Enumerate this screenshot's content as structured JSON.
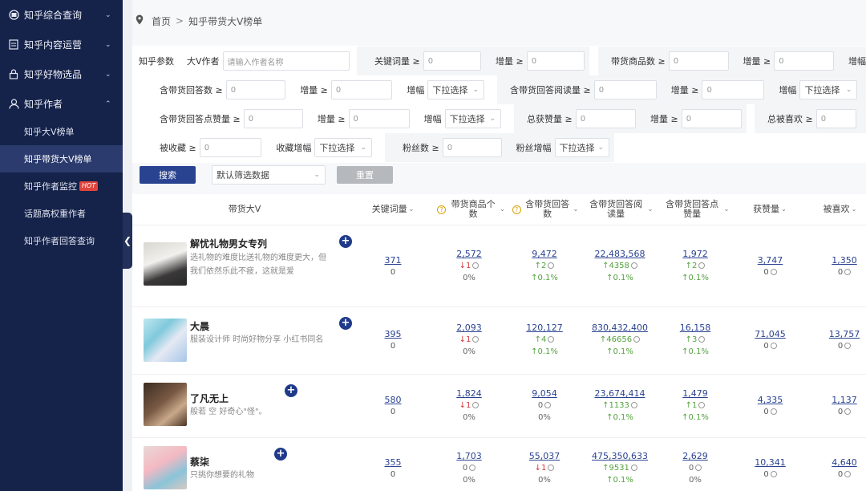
{
  "sidebar": {
    "groups": [
      {
        "label": "知乎综合查询",
        "icon": "globe-icon"
      },
      {
        "label": "知乎内容运营",
        "icon": "document-icon"
      },
      {
        "label": "知乎好物选品",
        "icon": "lock-icon"
      },
      {
        "label": "知乎作者",
        "icon": "user-icon"
      }
    ],
    "sub_items": [
      {
        "label": "知乎大V榜单"
      },
      {
        "label": "知乎带货大V榜单"
      },
      {
        "label": "知乎作者监控",
        "badge": "HOT"
      },
      {
        "label": "话题高权重作者"
      },
      {
        "label": "知乎作者回答查询"
      }
    ]
  },
  "breadcrumb": {
    "home": "首页",
    "separator": ">",
    "current": "知乎带货大V榜单"
  },
  "filters": {
    "section_label": "知乎参数",
    "author_label": "大V作者",
    "author_placeholder": "请输入作者名称",
    "keyword_label": "关键词量 ≥",
    "keyword_value": "0",
    "incr_label": "增量 ≥",
    "incr_value": "0",
    "goods_label": "带货商品数 ≥",
    "goods_value": "0",
    "growth_label": "增幅",
    "dropdown_text": "下拉选择",
    "answers_label": "含带货回答数 ≥",
    "answers_value": "0",
    "reads_label": "含带货回答阅读量 ≥",
    "reads_value": "0",
    "likes_label": "含带货回答点赞量 ≥",
    "likes_value": "0",
    "total_likes_label": "总获赞量 ≥",
    "total_likes_value": "0",
    "total_fav_label": "总被喜欢 ≥",
    "total_fav_value": "0",
    "collect_label": "被收藏 ≥",
    "collect_value": "0",
    "collect_growth_label": "收藏增幅",
    "fans_label": "粉丝数 ≥",
    "fans_value": "0",
    "fans_growth_label": "粉丝增幅",
    "search_button": "搜索",
    "preset_text": "默认筛选数据",
    "reset_button": "重置"
  },
  "table": {
    "headers": {
      "author": "带货大V",
      "keyword": "关键词量",
      "goods": "带货商品个数",
      "answers": "含带货回答数",
      "reads": "含带货回答阅读量",
      "likes": "含带货回答点赞量",
      "total_likes": "获赞量",
      "favs": "被喜欢"
    },
    "rows": [
      {
        "name": "解忧礼物男女专列",
        "desc": "选礼物的难度比送礼物的难度更大，但我们依然乐此不疲，这就是爱",
        "keyword": {
          "v": "371",
          "d": "0"
        },
        "goods": {
          "v": "2,572",
          "c": "↓1",
          "p": "0%"
        },
        "answers": {
          "v": "9,472",
          "c": "↑2",
          "p": "↑0.1%"
        },
        "reads": {
          "v": "22,483,568",
          "c": "↑4358",
          "p": "↑0.1%"
        },
        "likes": {
          "v": "1,972",
          "c": "↑2",
          "p": "↑0.1%"
        },
        "total_likes": {
          "v": "3,747",
          "d": "0"
        },
        "favs": {
          "v": "1,350",
          "d": "0"
        }
      },
      {
        "name": "大晨",
        "desc": "服装设计师 时尚好物分享 小红书同名",
        "keyword": {
          "v": "395",
          "d": "0"
        },
        "goods": {
          "v": "2,093",
          "c": "↓1",
          "p": "0%"
        },
        "answers": {
          "v": "120,127",
          "c": "↑4",
          "p": "↑0.1%"
        },
        "reads": {
          "v": "830,432,400",
          "c": "↑46656",
          "p": "↑0.1%"
        },
        "likes": {
          "v": "16,158",
          "c": "↑3",
          "p": "↑0.1%"
        },
        "total_likes": {
          "v": "71,045",
          "d": "0"
        },
        "favs": {
          "v": "13,757",
          "d": "0"
        }
      },
      {
        "name": "了凡无上",
        "desc": "般若 空 好奇心\"怪\"。",
        "keyword": {
          "v": "580",
          "d": "0"
        },
        "goods": {
          "v": "1,824",
          "c": "↓1",
          "p": "0%"
        },
        "answers": {
          "v": "9,054",
          "c": "0",
          "p": "0%"
        },
        "reads": {
          "v": "23,674,414",
          "c": "↑1133",
          "p": "↑0.1%"
        },
        "likes": {
          "v": "1,479",
          "c": "↑1",
          "p": "↑0.1%"
        },
        "total_likes": {
          "v": "4,335",
          "d": "0"
        },
        "favs": {
          "v": "1,137",
          "d": "0"
        }
      },
      {
        "name": "蔡柒",
        "desc": "只挑你想要的礼物",
        "keyword": {
          "v": "355",
          "d": "0"
        },
        "goods": {
          "v": "1,703",
          "c": "0",
          "p": "0%"
        },
        "answers": {
          "v": "55,037",
          "c": "↓1",
          "p": "0%"
        },
        "reads": {
          "v": "475,350,633",
          "c": "↑9531",
          "p": "↑0.1%"
        },
        "likes": {
          "v": "2,629",
          "c": "0",
          "p": "0%"
        },
        "total_likes": {
          "v": "10,341",
          "d": "0"
        },
        "favs": {
          "v": "4,640",
          "d": "0"
        }
      }
    ]
  },
  "colors": {
    "sidebar_bg": "#15224a",
    "primary": "#2a4391",
    "up": "#53a23e",
    "down": "#d9343a"
  }
}
